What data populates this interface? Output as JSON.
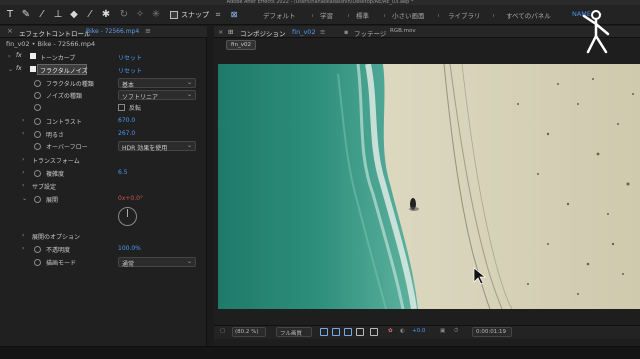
{
  "window": {
    "title": "Adobe After Effects 2022 - /Users/hanaokadaishin/Desktop/AE/AE_03.aep *"
  },
  "toolbar": {
    "tools": [
      {
        "icon": "type-tool-icon",
        "glyph": "T"
      },
      {
        "icon": "pen-tool-icon",
        "glyph": "✎"
      },
      {
        "icon": "brush-tool-icon",
        "glyph": "⁄"
      },
      {
        "icon": "stamp-tool-icon",
        "glyph": "⊥"
      },
      {
        "icon": "eraser-tool-icon",
        "glyph": "◆"
      },
      {
        "icon": "roto-brush-icon",
        "glyph": "⁄"
      },
      {
        "icon": "puppet-pin-icon",
        "glyph": "✱"
      }
    ],
    "snap_label": "スナップ",
    "workspaces": [
      {
        "label": "デフォルト",
        "active": false
      },
      {
        "label": "学習",
        "active": false
      },
      {
        "label": "標準",
        "active": false
      },
      {
        "label": "小さい画面",
        "active": false
      },
      {
        "label": "ライブラリ",
        "active": false
      },
      {
        "label": "すべてのパネル",
        "active": false
      },
      {
        "label": "NAME",
        "active": true
      }
    ],
    "menu_glyph": "»"
  },
  "effect_panel": {
    "tab_label": "エフェクトコントロール",
    "tab_file": "Bike - 72566.mp4",
    "layer_path": "fin_v02 • Bike - 72566.mp4",
    "effects": [
      {
        "name": "トーンカーブ",
        "reset": "リセット"
      },
      {
        "name": "フラクタルノイズ",
        "reset": "リセット"
      }
    ],
    "properties": [
      {
        "label": "フラクタルの種類",
        "type": "dropdown",
        "value": "基本"
      },
      {
        "label": "ノイズの種類",
        "type": "dropdown",
        "value": "ソフトリニア"
      },
      {
        "label": "",
        "type": "checkbox",
        "value": "反転"
      },
      {
        "label": "コントラスト",
        "type": "number",
        "value": "670.0"
      },
      {
        "label": "明るさ",
        "type": "number",
        "value": "267.0"
      },
      {
        "label": "オーバーフロー",
        "type": "dropdown",
        "value": "HDR 効果を使用"
      },
      {
        "label": "トランスフォーム",
        "type": "group",
        "value": ""
      },
      {
        "label": "複雑度",
        "type": "number",
        "value": "6.5"
      },
      {
        "label": "サブ設定",
        "type": "group",
        "value": ""
      },
      {
        "label": "展開",
        "type": "angle",
        "value": "0x+0.0°"
      },
      {
        "label": "展開のオプション",
        "type": "group",
        "value": ""
      },
      {
        "label": "不透明度",
        "type": "number",
        "value": "100.0%"
      },
      {
        "label": "描画モード",
        "type": "dropdown",
        "value": "通常"
      }
    ]
  },
  "composition_panel": {
    "tab_label": "コンポジション",
    "tab_name": "fin_v02",
    "footage_label": "フッテージ",
    "footage_name": "RGB.mov",
    "sub_tab": "fin_v02",
    "bottom": {
      "zoom": "(80.2 %)",
      "quality": "フル画質",
      "exposure": "+0.0",
      "timecode": "0:00:01:19"
    }
  },
  "colors": {
    "accent": "#4a9cf5",
    "warning": "#d05050"
  }
}
